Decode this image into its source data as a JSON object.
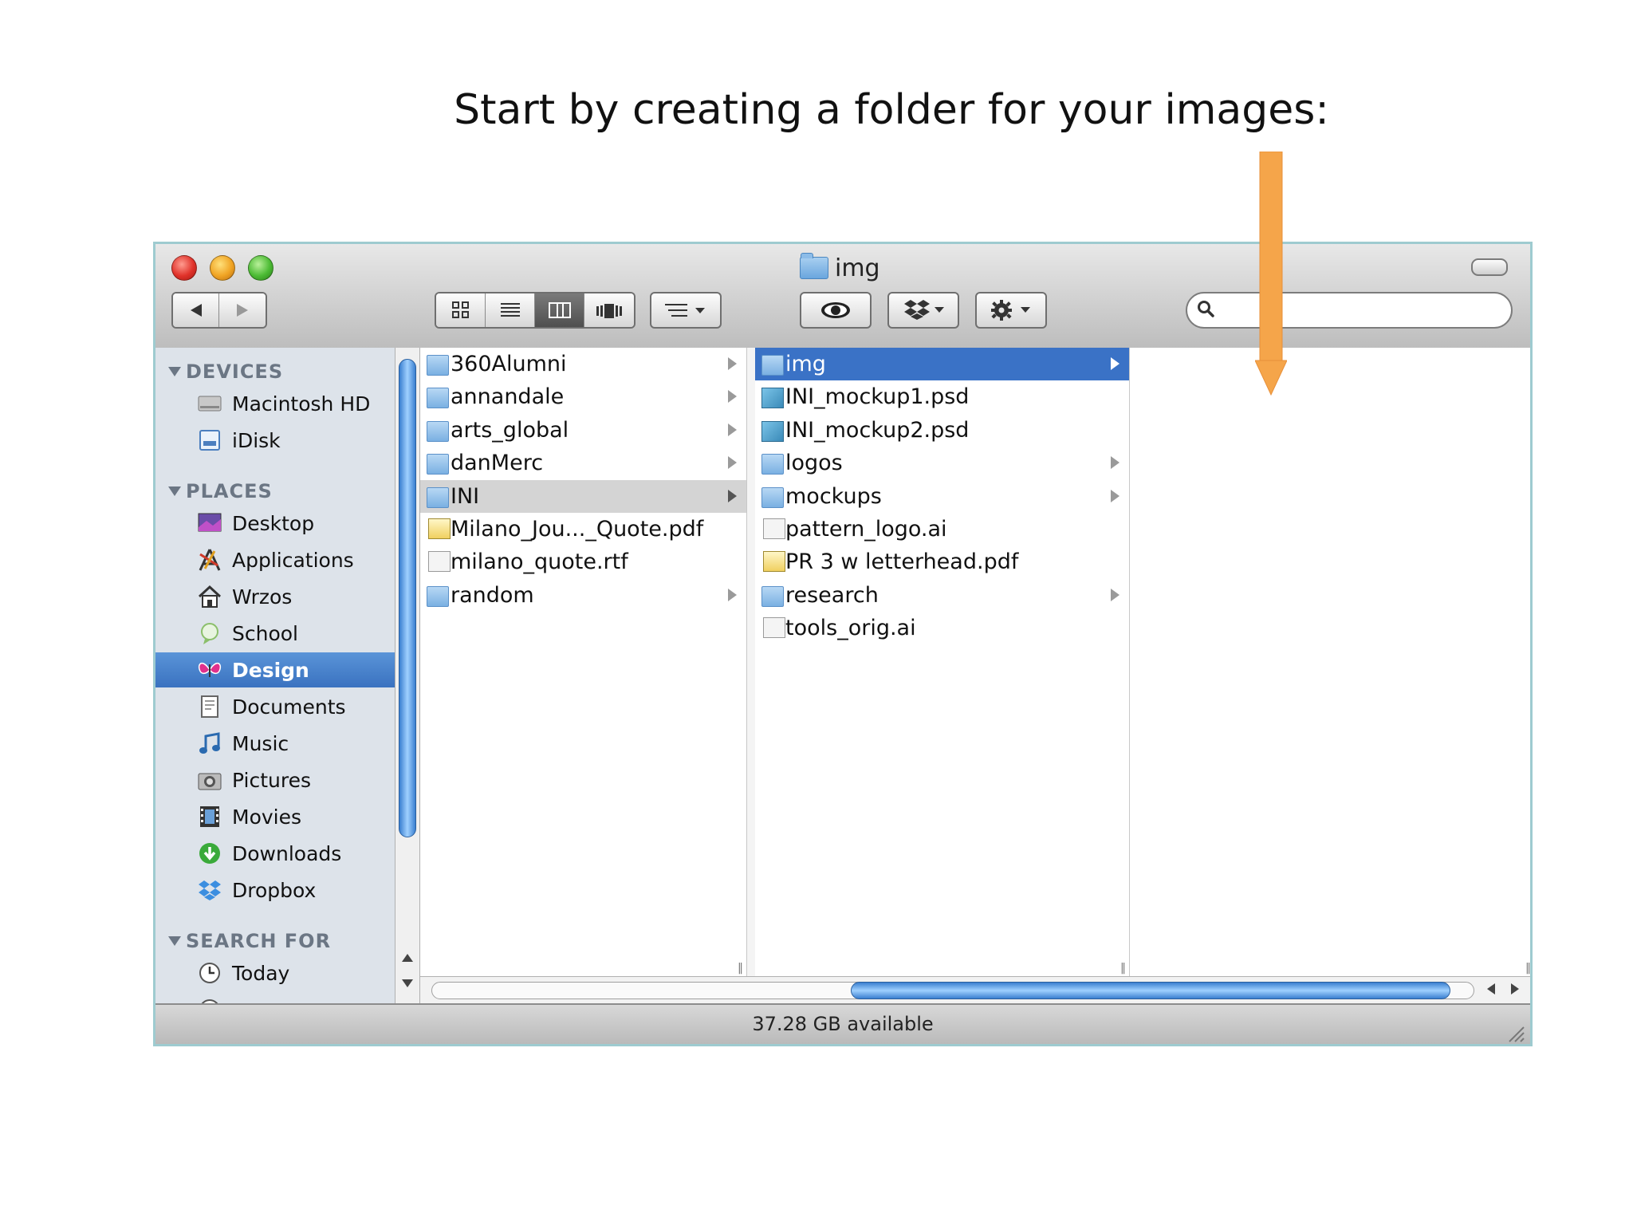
{
  "caption": "Start by creating a folder for your images:",
  "colors": {
    "arrow": "#f5a54a",
    "selection": "#3a72c6",
    "sidebar_bg": "#dde3ea",
    "accent_red": "#c0392b"
  },
  "window": {
    "title": "img",
    "title_icon": "folder-icon",
    "toolbar": {
      "nav": [
        "back-arrow-icon",
        "forward-arrow-icon"
      ],
      "view_modes": [
        "icon-view-icon",
        "list-view-icon",
        "column-view-icon",
        "coverflow-view-icon"
      ],
      "active_view": "column",
      "arrange_icon": "arrange-icon",
      "quicklook_icon": "eye-icon",
      "dropbox_icon": "dropbox-icon",
      "action_icon": "gear-icon",
      "search_icon": "search-icon",
      "search_value": ""
    },
    "sidebar": {
      "sections": [
        {
          "header": "DEVICES",
          "items": [
            {
              "label": "Macintosh HD",
              "icon": "hard-drive-icon"
            },
            {
              "label": "iDisk",
              "icon": "idisk-icon"
            }
          ]
        },
        {
          "header": "PLACES",
          "items": [
            {
              "label": "Desktop",
              "icon": "desktop-icon"
            },
            {
              "label": "Applications",
              "icon": "applications-icon"
            },
            {
              "label": "Wrzos",
              "icon": "home-icon"
            },
            {
              "label": "School",
              "icon": "school-icon"
            },
            {
              "label": "Design",
              "icon": "design-icon",
              "selected": true
            },
            {
              "label": "Documents",
              "icon": "documents-icon"
            },
            {
              "label": "Music",
              "icon": "music-icon"
            },
            {
              "label": "Pictures",
              "icon": "pictures-icon"
            },
            {
              "label": "Movies",
              "icon": "movies-icon"
            },
            {
              "label": "Downloads",
              "icon": "downloads-icon"
            },
            {
              "label": "Dropbox",
              "icon": "dropbox-icon"
            }
          ]
        },
        {
          "header": "SEARCH FOR",
          "items": [
            {
              "label": "Today",
              "icon": "clock-icon"
            }
          ]
        }
      ]
    },
    "columns": [
      {
        "items": [
          {
            "name": "360Alumni",
            "type": "folder",
            "has_children": true
          },
          {
            "name": "annandale",
            "type": "folder",
            "has_children": true
          },
          {
            "name": "arts_global",
            "type": "folder",
            "has_children": true
          },
          {
            "name": "danMerc",
            "type": "folder",
            "has_children": true
          },
          {
            "name": "INI",
            "type": "folder",
            "has_children": true,
            "selected": "inactive"
          },
          {
            "name": "Milano_Jou..._Quote.pdf",
            "type": "pdf",
            "has_children": false
          },
          {
            "name": "milano_quote.rtf",
            "type": "doc",
            "has_children": false
          },
          {
            "name": "random",
            "type": "folder",
            "has_children": true
          }
        ]
      },
      {
        "items": [
          {
            "name": "img",
            "type": "folder",
            "has_children": true,
            "selected": "active"
          },
          {
            "name": "INI_mockup1.psd",
            "type": "psd",
            "has_children": false
          },
          {
            "name": "INI_mockup2.psd",
            "type": "psd",
            "has_children": false
          },
          {
            "name": "logos",
            "type": "folder",
            "has_children": true
          },
          {
            "name": "mockups",
            "type": "folder",
            "has_children": true
          },
          {
            "name": "pattern_logo.ai",
            "type": "doc",
            "has_children": false
          },
          {
            "name": "PR 3 w letterhead.pdf",
            "type": "pdf",
            "has_children": false
          },
          {
            "name": "research",
            "type": "folder",
            "has_children": true
          },
          {
            "name": "tools_orig.ai",
            "type": "doc",
            "has_children": false
          }
        ]
      },
      {
        "items": []
      }
    ],
    "status": "37.28 GB available"
  }
}
